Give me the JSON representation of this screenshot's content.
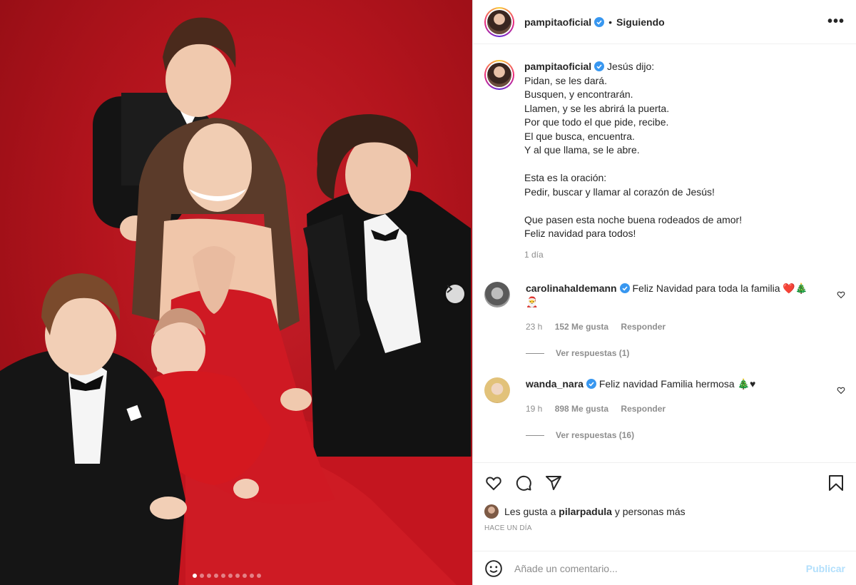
{
  "post": {
    "username": "pampitaoficial",
    "separator": "•",
    "follow_status": "Siguiendo",
    "more_label": "•••",
    "caption": {
      "username": "pampitaoficial",
      "lines": [
        "Jesús dijo:",
        "Pidan, se les dará.",
        "Busquen, y encontrarán.",
        "Llamen, y se les abrirá la puerta.",
        "Por que todo el que pide, recibe.",
        "El que busca, encuentra.",
        "Y al que llama, se le abre.",
        "",
        "Esta es la oración:",
        "Pedir, buscar y llamar al corazón de Jesús!",
        "",
        "Que pasen esta noche buena rodeados de amor!",
        "Feliz navidad para todos!"
      ],
      "time": "1 día"
    },
    "comments": [
      {
        "username": "carolinahaldemann",
        "text": "Feliz Navidad para toda la familia ❤️🎄",
        "text_line2": "🎅",
        "time": "23 h",
        "likes": "152 Me gusta",
        "reply": "Responder",
        "view_replies": "Ver respuestas (1)"
      },
      {
        "username": "wanda_nara",
        "text": "Feliz navidad Familia hermosa 🎄♥",
        "time": "19 h",
        "likes": "898 Me gusta",
        "reply": "Responder",
        "view_replies": "Ver respuestas (16)"
      }
    ],
    "likes_text_prefix": "Les gusta a ",
    "likes_user": "pilarpadula",
    "likes_text_suffix": " y personas más",
    "posted_ago": "HACE UN DÍA",
    "comment_placeholder": "Añade un comentario...",
    "publish_label": "Publicar",
    "carousel": {
      "count": 10,
      "active_index": 0
    }
  },
  "colors": {
    "accent_verified": "#3897f0",
    "publish_disabled": "#b2dffc",
    "muted": "#8e8e8e",
    "backdrop_red": "#b3141d"
  },
  "icons": [
    "verified-icon",
    "more-icon",
    "heart-icon",
    "comment-icon",
    "share-icon",
    "save-icon",
    "emoji-icon",
    "chevron-right-icon"
  ]
}
